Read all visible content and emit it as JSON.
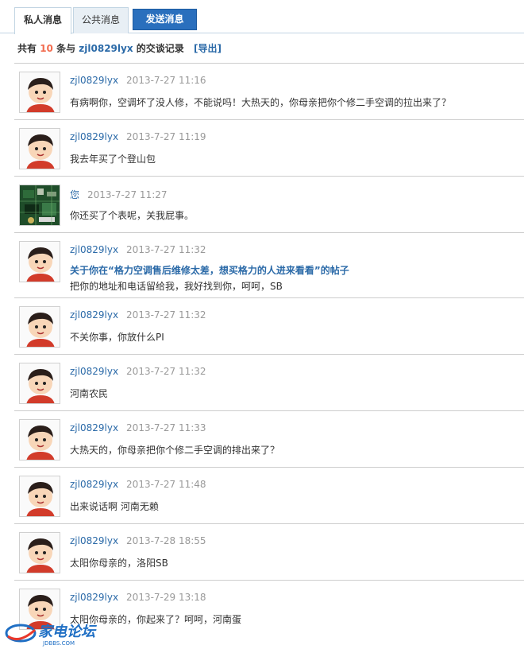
{
  "tabs": {
    "private": "私人消息",
    "public": "公共消息",
    "send": "发送消息"
  },
  "summary": {
    "prefix": "共有",
    "count": "10",
    "middle": "条与",
    "username": "zjl0829lyx",
    "suffix": "的交谈记录",
    "export": "[导出]"
  },
  "messages": [
    {
      "author": "zjl0829lyx",
      "time": "2013-7-27 11:16",
      "text": "有病啊你，空调坏了没人修，不能说吗！大热天的，你母亲把你个修二手空调的拉出来了？",
      "avatar": "cartoon-boy"
    },
    {
      "author": "zjl0829lyx",
      "time": "2013-7-27 11:19",
      "text": "我去年买了个登山包",
      "avatar": "cartoon-boy"
    },
    {
      "author": "您",
      "time": "2013-7-27 11:27",
      "text": "你还买了个表呢，关我屁事。",
      "avatar": "circuit-board"
    },
    {
      "author": "zjl0829lyx",
      "time": "2013-7-27 11:32",
      "subject": "关于你在“格力空调售后维修太差，想买格力的人进来看看”的帖子",
      "text": "把你的地址和电话留给我，我好找到你，呵呵，SB",
      "avatar": "cartoon-boy"
    },
    {
      "author": "zjl0829lyx",
      "time": "2013-7-27 11:32",
      "text": "不关你事，你放什么PI",
      "avatar": "cartoon-boy"
    },
    {
      "author": "zjl0829lyx",
      "time": "2013-7-27 11:32",
      "text": "河南农民",
      "avatar": "cartoon-boy"
    },
    {
      "author": "zjl0829lyx",
      "time": "2013-7-27 11:33",
      "text": "大热天的，你母亲把你个修二手空调的排出来了？",
      "avatar": "cartoon-boy"
    },
    {
      "author": "zjl0829lyx",
      "time": "2013-7-27 11:48",
      "text": "出来说话啊 河南无赖",
      "avatar": "cartoon-boy"
    },
    {
      "author": "zjl0829lyx",
      "time": "2013-7-28 18:55",
      "text": "太阳你母亲的，洛阳SB",
      "avatar": "cartoon-boy"
    },
    {
      "author": "zjl0829lyx",
      "time": "2013-7-29 13:18",
      "text": "太阳你母亲的，你起来了？呵呵，河南蛋",
      "avatar": "cartoon-boy"
    }
  ],
  "watermark": {
    "name": "家电论坛",
    "domain": "JDBBS.COM"
  }
}
